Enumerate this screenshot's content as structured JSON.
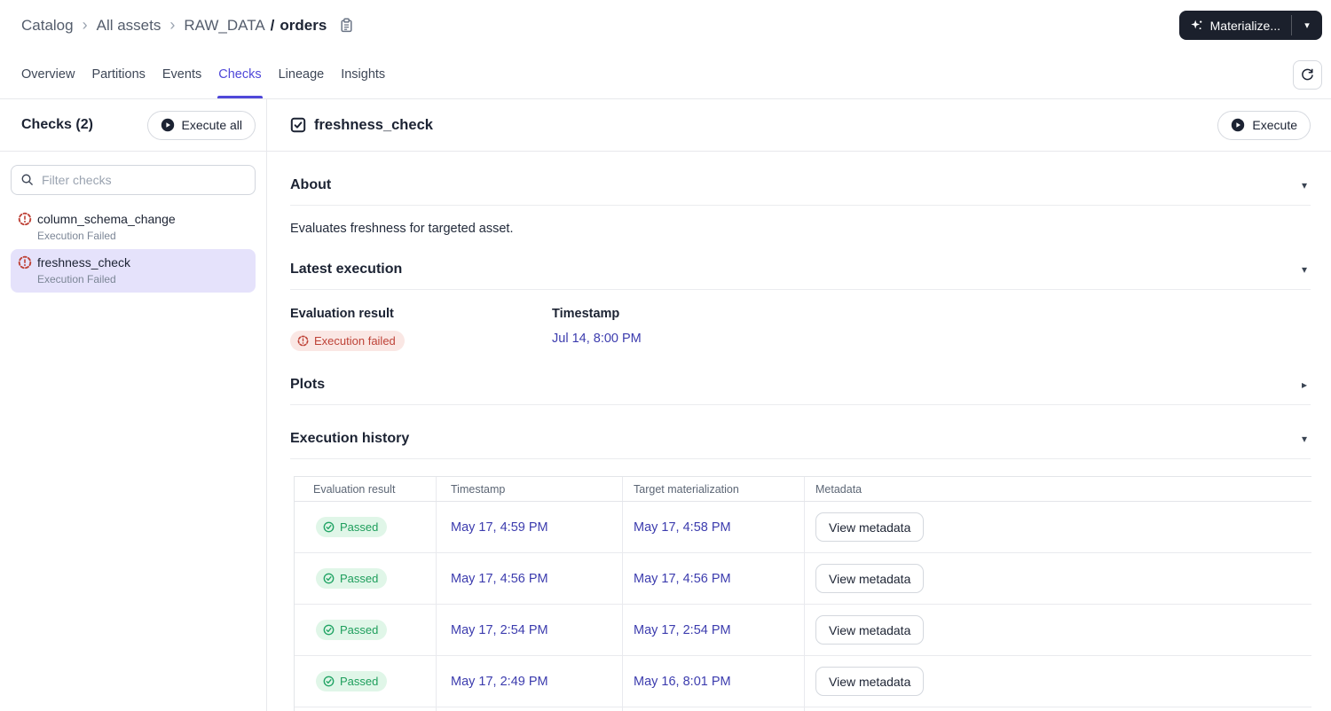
{
  "icons": {
    "breadcrumb_sep": "›",
    "dropdown_caret": "▾",
    "caret_down": "▾",
    "caret_right": "▸"
  },
  "colors": {
    "accent": "#5048D9",
    "link": "#3C3CAE",
    "success_text": "#1E9E5C",
    "success_bg": "#E0F6E8",
    "error_text": "#BE4237",
    "error_bg": "#FAE7E4",
    "dark_button_bg": "#1B202C",
    "selected_item_bg": "#E5E2FB"
  },
  "breadcrumb": {
    "catalog": "Catalog",
    "all_assets": "All assets",
    "asset_prefix": "RAW_DATA",
    "path_separator": "/",
    "asset_name": "orders"
  },
  "materialize": {
    "label": "Materialize..."
  },
  "tabs": [
    {
      "label": "Overview"
    },
    {
      "label": "Partitions"
    },
    {
      "label": "Events"
    },
    {
      "label": "Checks"
    },
    {
      "label": "Lineage"
    },
    {
      "label": "Insights"
    }
  ],
  "active_tab": "Checks",
  "sidebar": {
    "title": "Checks (2)",
    "execute_all_label": "Execute all",
    "filter_placeholder": "Filter checks",
    "items": [
      {
        "name": "column_schema_change",
        "status": "Execution Failed"
      },
      {
        "name": "freshness_check",
        "status": "Execution Failed"
      }
    ]
  },
  "detail": {
    "title": "freshness_check",
    "execute_label": "Execute",
    "about": {
      "heading": "About",
      "description": "Evaluates freshness for targeted asset."
    },
    "latest_execution": {
      "heading": "Latest execution",
      "evaluation_result_label": "Evaluation result",
      "evaluation_result": "Execution failed",
      "timestamp_label": "Timestamp",
      "timestamp": "Jul 14, 8:00 PM"
    },
    "plots": {
      "heading": "Plots"
    },
    "history": {
      "heading": "Execution history",
      "columns": [
        "Evaluation result",
        "Timestamp",
        "Target materialization",
        "Metadata"
      ],
      "view_metadata_label": "View metadata",
      "rows": [
        {
          "result": "Passed",
          "timestamp": "May 17, 4:59 PM",
          "target": "May 17, 4:58 PM"
        },
        {
          "result": "Passed",
          "timestamp": "May 17, 4:56 PM",
          "target": "May 17, 4:56 PM"
        },
        {
          "result": "Passed",
          "timestamp": "May 17, 2:54 PM",
          "target": "May 17, 2:54 PM"
        },
        {
          "result": "Passed",
          "timestamp": "May 17, 2:49 PM",
          "target": "May 16, 8:01 PM"
        }
      ]
    }
  }
}
